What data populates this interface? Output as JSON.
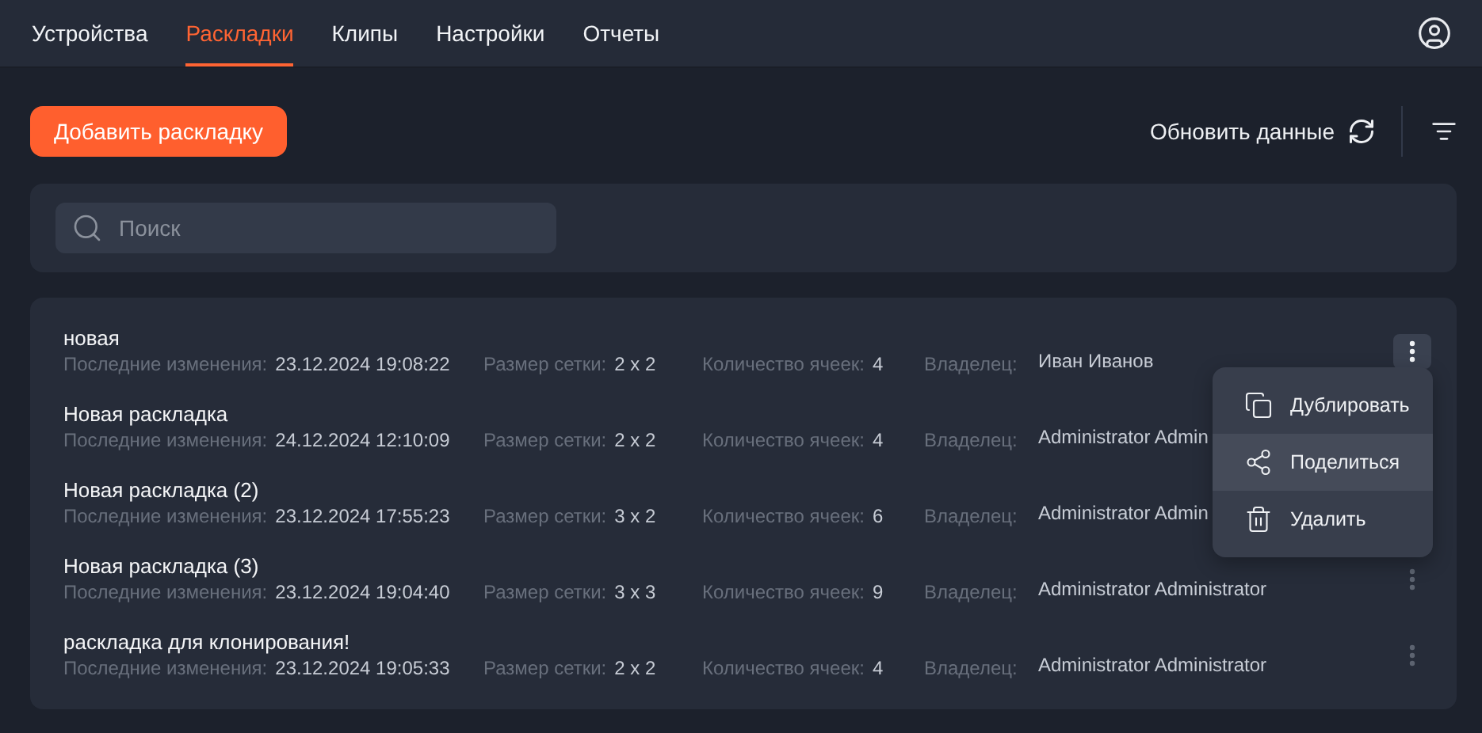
{
  "nav": {
    "tabs": [
      {
        "label": "Устройства",
        "selected": false
      },
      {
        "label": "Раскладки",
        "selected": true
      },
      {
        "label": "Клипы",
        "selected": false
      },
      {
        "label": "Настройки",
        "selected": false
      },
      {
        "label": "Отчеты",
        "selected": false
      }
    ]
  },
  "toolbar": {
    "add_button": "Добавить раскладку",
    "refresh": "Обновить данные"
  },
  "search": {
    "placeholder": "Поиск"
  },
  "layouts": [
    {
      "name": "новая",
      "changed_label": "Последние изменения:",
      "changed": "23.12.2024 19:08:22",
      "grid_label": "Размер сетки:",
      "grid": "2 x 2",
      "cells_label": "Количество ячеек:",
      "cells": "4",
      "owner_label": "Владелец:",
      "owner": "Иван Иванов",
      "menu_open": true
    },
    {
      "name": "Новая раскладка",
      "changed_label": "Последние изменения:",
      "changed": "24.12.2024 12:10:09",
      "grid_label": "Размер сетки:",
      "grid": "2 x 2",
      "cells_label": "Количество ячеек:",
      "cells": "4",
      "owner_label": "Владелец:",
      "owner": "Administrator Admin"
    },
    {
      "name": "Новая раскладка (2)",
      "changed_label": "Последние изменения:",
      "changed": "23.12.2024 17:55:23",
      "grid_label": "Размер сетки:",
      "grid": "3 x 2",
      "cells_label": "Количество ячеек:",
      "cells": "6",
      "owner_label": "Владелец:",
      "owner": "Administrator Admin"
    },
    {
      "name": "Новая раскладка (3)",
      "changed_label": "Последние изменения:",
      "changed": "23.12.2024 19:04:40",
      "grid_label": "Размер сетки:",
      "grid": "3 x 3",
      "cells_label": "Количество ячеек:",
      "cells": "9",
      "owner_label": "Владелец:",
      "owner": "Administrator Administrator",
      "menu_open": false
    },
    {
      "name": "раскладка для клонирования!",
      "changed_label": "Последние изменения:",
      "changed": "23.12.2024 19:05:33",
      "grid_label": "Размер сетки:",
      "grid": "2 x 2",
      "cells_label": "Количество ячеек:",
      "cells": "4",
      "owner_label": "Владелец:",
      "owner": "Administrator Administrator",
      "menu_open": false
    }
  ],
  "context_menu": {
    "items": [
      {
        "kind": "copy",
        "label": "Дублировать",
        "selected": false
      },
      {
        "kind": "share",
        "label": "Поделиться",
        "selected": true
      },
      {
        "kind": "delete",
        "label": "Удалить",
        "selected": false
      }
    ]
  }
}
